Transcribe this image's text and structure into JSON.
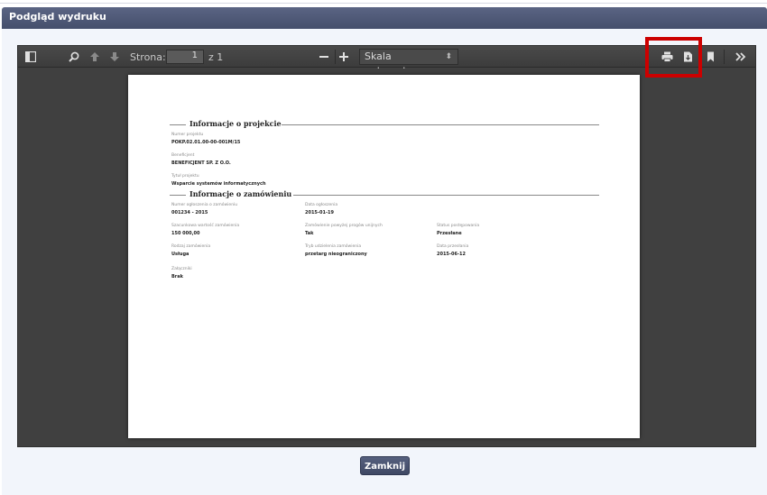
{
  "dialog": {
    "title": "Podgląd wydruku",
    "close_label": "Zamknij"
  },
  "toolbar": {
    "page_label": "Strona:",
    "page_value": "1",
    "page_total": "z 1",
    "scale_value": "Skala automatyczna",
    "icons": [
      "sidebar-toggle-icon",
      "search-icon",
      "page-up-icon",
      "page-down-icon",
      "zoom-out-icon",
      "zoom-in-icon",
      "print-icon",
      "download-icon",
      "bookmark-icon",
      "tools-icon"
    ]
  },
  "document": {
    "section1_title": "Informacje o projekcie",
    "section2_title": "Informacje o zamówieniu",
    "project_number_label": "Numer projektu",
    "project_number": "POKP.02.01.00-00-001M/15",
    "beneficiary_label": "Beneficjent",
    "beneficiary": "BENEFICJENT SP. Z O.O.",
    "project_title_label": "Tytuł projektu",
    "project_title": "Wsparcie systemów informatycznych",
    "order_number_label": "Numer ogłoszenia o zamówieniu",
    "order_number": "001234 - 2015",
    "announce_date_label": "Data ogłoszenia",
    "announce_date": "2015-01-19",
    "est_value_label": "Szacunkowa wartość zamówienia",
    "est_value": "150 000,00",
    "threshold_label": "Zamówienie powyżej progów unijnych",
    "threshold": "Tak",
    "status_label": "Status postępowania",
    "status": "Przesłane",
    "order_type_label": "Rodzaj zamówienia",
    "order_type": "Usługa",
    "mode_label": "Tryb udzielenia zamówienia",
    "mode": "przetarg nieograniczony",
    "send_date_label": "Data przesłania",
    "send_date": "2015-06-12",
    "attachments_label": "Załączniki",
    "attachments": "Brak"
  },
  "colors": {
    "titlebar": "#4e5877",
    "viewer_bg": "#404040",
    "highlight": "#cc0000"
  }
}
